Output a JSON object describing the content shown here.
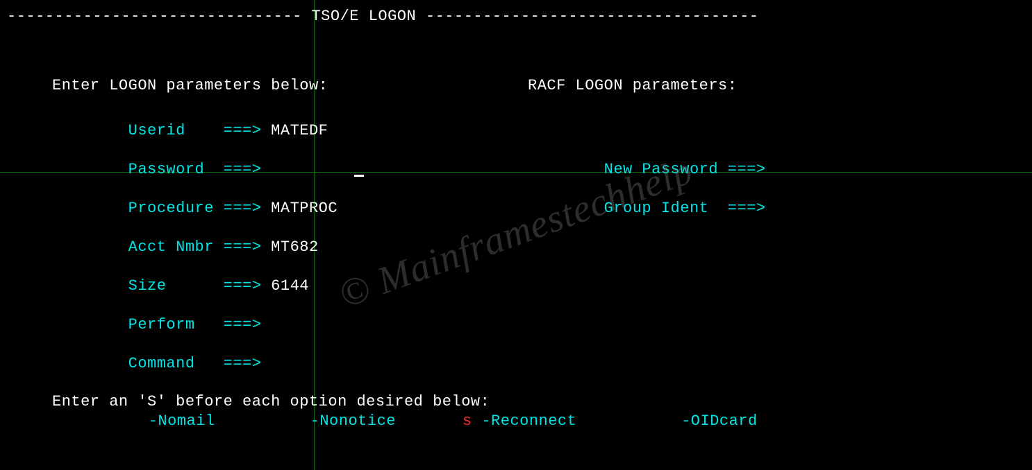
{
  "title_line": "------------------------------- TSO/E LOGON -----------------------------------",
  "headings": {
    "left": "Enter LOGON parameters below:",
    "right": "RACF LOGON parameters:"
  },
  "arrow": "===>",
  "fields": {
    "userid": {
      "label": "Userid   ",
      "value": "MATEDF",
      "color": "white"
    },
    "password": {
      "label": "Password ",
      "value": "",
      "color": "white"
    },
    "procedure": {
      "label": "Procedure",
      "value": "MATPROC",
      "color": "red"
    },
    "acct": {
      "label": "Acct Nmbr",
      "value": "MT682",
      "color": "red"
    },
    "size": {
      "label": "Size     ",
      "value": "6144",
      "color": "red"
    },
    "perform": {
      "label": "Perform  ",
      "value": "",
      "color": "white"
    },
    "command": {
      "label": "Command  ",
      "value": "",
      "color": "white"
    }
  },
  "racf": {
    "newpassword": {
      "label": "New Password",
      "value": ""
    },
    "groupident": {
      "label": "Group Ident ",
      "value": ""
    }
  },
  "options_prompt": "Enter an 'S' before each option desired below:",
  "options": {
    "nomail": {
      "flag": "",
      "label": "-Nomail"
    },
    "nonotice": {
      "flag": "",
      "label": "-Nonotice"
    },
    "reconnect": {
      "flag": "s",
      "label": "-Reconnect"
    },
    "oidcard": {
      "flag": "",
      "label": "-OIDcard"
    }
  },
  "watermark": "© Mainframestechhelp"
}
